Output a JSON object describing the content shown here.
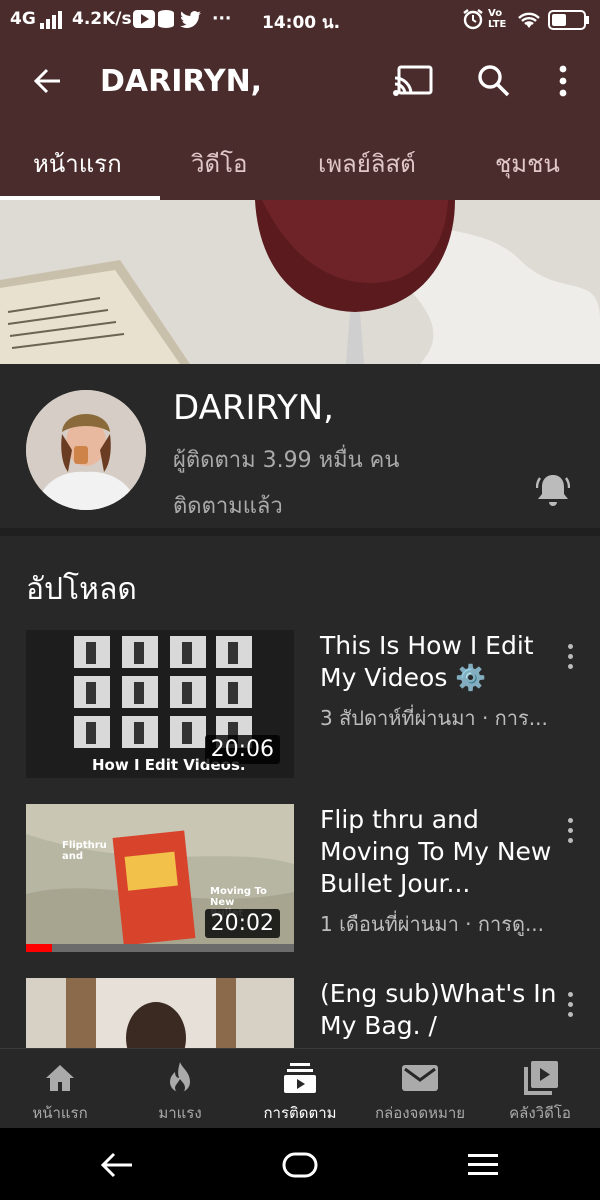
{
  "status_bar": {
    "network": "4G",
    "speed": "4.2K/s",
    "more": "···",
    "time": "14:00 น.",
    "volte": "Vo LTE"
  },
  "app_bar": {
    "title": "DARIRYN,",
    "tabs": [
      "หน้าแรก",
      "วิดีโอ",
      "เพลย์ลิสต์",
      "ชุมชน"
    ]
  },
  "channel": {
    "name": "DARIRYN,",
    "subscribers": "ผู้ติดตาม 3.99 หมื่น คน",
    "subscribed_label": "ติดตามแล้ว"
  },
  "uploads": {
    "title": "อัปโหลด",
    "videos": [
      {
        "title": "This Is How I Edit My Videos ⚙️",
        "meta": "3 สัปดาห์ที่ผ่านมา · การ...",
        "duration": "20:06",
        "thumb_caption": "How I Edit Videos."
      },
      {
        "title": "Flip thru and Moving To My New Bullet Jour...",
        "meta": "1 เดือนที่ผ่านมา · การดู...",
        "duration": "20:02",
        "thumb_text_left": "Flipthru and",
        "thumb_text_right": "Moving To New Bullet"
      },
      {
        "title": "(Eng sub)What's In My Bag. /",
        "meta": "",
        "duration": ""
      }
    ]
  },
  "bottom_nav": [
    {
      "label": "หน้าแรก",
      "icon": "home-icon"
    },
    {
      "label": "มาแรง",
      "icon": "trending-icon"
    },
    {
      "label": "การติดตาม",
      "icon": "subscriptions-icon"
    },
    {
      "label": "กล่องจดหมาย",
      "icon": "inbox-icon"
    },
    {
      "label": "คลังวิดีโอ",
      "icon": "library-icon"
    }
  ],
  "colors": {
    "header_bg": "#4a2c2c",
    "body_bg": "#282828",
    "progress_red": "#ff0000"
  }
}
